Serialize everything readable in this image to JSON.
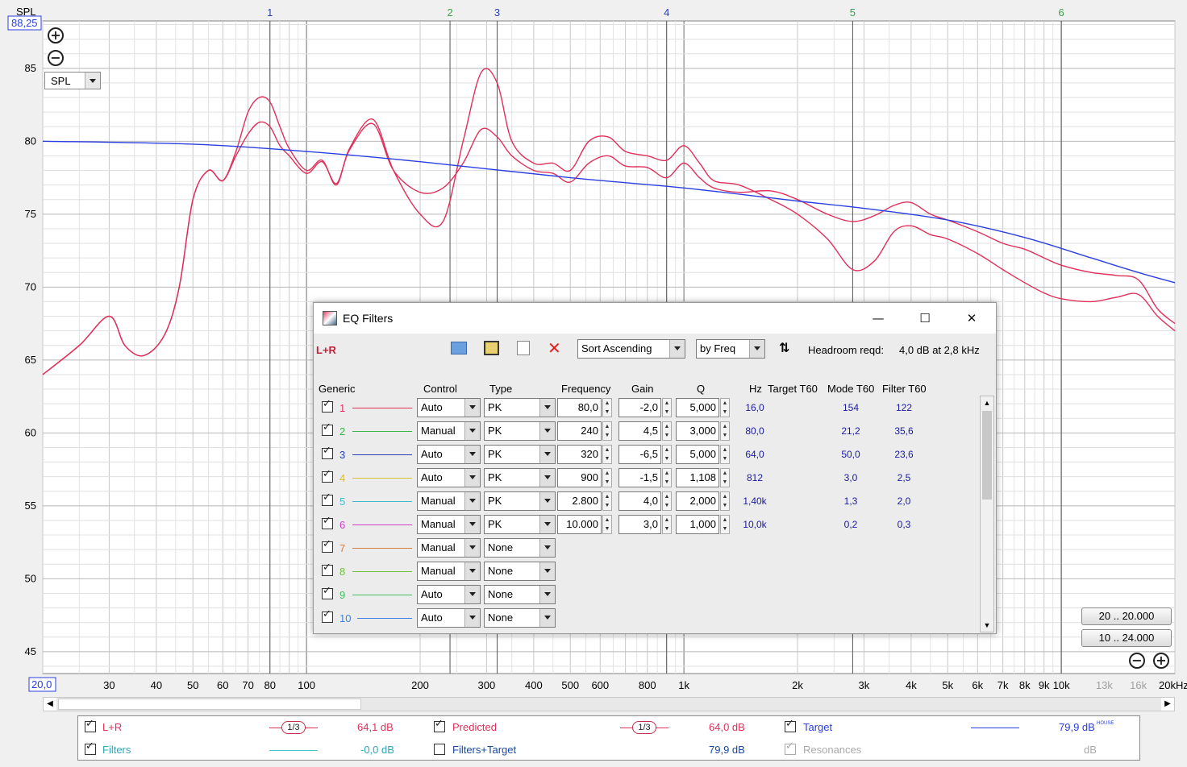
{
  "chart_data": {
    "type": "line",
    "x_scale": "log",
    "xlim": [
      20,
      20000
    ],
    "ylim": [
      43.5,
      88.25
    ],
    "ylabel": "SPL",
    "y_top_readout": "88,25",
    "x_left_readout": "20,0",
    "yticks": [
      85,
      80,
      75,
      70,
      65,
      60,
      55,
      50,
      45
    ],
    "xticks": [
      {
        "v": 30,
        "label": "30"
      },
      {
        "v": 40,
        "label": "40"
      },
      {
        "v": 50,
        "label": "50"
      },
      {
        "v": 60,
        "label": "60"
      },
      {
        "v": 70,
        "label": "70"
      },
      {
        "v": 80,
        "label": "80"
      },
      {
        "v": 100,
        "label": "100"
      },
      {
        "v": 200,
        "label": "200"
      },
      {
        "v": 300,
        "label": "300"
      },
      {
        "v": 400,
        "label": "400"
      },
      {
        "v": 500,
        "label": "500"
      },
      {
        "v": 600,
        "label": "600"
      },
      {
        "v": 800,
        "label": "800"
      },
      {
        "v": 1000,
        "label": "1k"
      },
      {
        "v": 2000,
        "label": "2k"
      },
      {
        "v": 3000,
        "label": "3k"
      },
      {
        "v": 4000,
        "label": "4k"
      },
      {
        "v": 5000,
        "label": "5k"
      },
      {
        "v": 6000,
        "label": "6k"
      },
      {
        "v": 7000,
        "label": "7k"
      },
      {
        "v": 8000,
        "label": "8k"
      },
      {
        "v": 9000,
        "label": "9k"
      },
      {
        "v": 10000,
        "label": "10k"
      },
      {
        "v": 13000,
        "label": "13k",
        "dim": true
      },
      {
        "v": 16000,
        "label": "16k",
        "dim": true
      },
      {
        "v": 20000,
        "label": "20kHz"
      }
    ],
    "filter_markers": [
      {
        "label": "1",
        "freq": 80,
        "color": "#2a3fb5"
      },
      {
        "label": "2",
        "freq": 240,
        "color": "#3aa04a"
      },
      {
        "label": "3",
        "freq": 320,
        "color": "#2a3fb5"
      },
      {
        "label": "4",
        "freq": 900,
        "color": "#2a3fb5"
      },
      {
        "label": "5",
        "freq": 2800,
        "color": "#3aa04a"
      },
      {
        "label": "6",
        "freq": 10000,
        "color": "#3aa04a"
      }
    ],
    "series": [
      {
        "name": "L+R",
        "color": "#e0305a",
        "x": [
          20,
          25,
          30,
          33,
          37,
          42,
          46,
          50,
          55,
          60,
          65,
          70,
          75,
          80,
          85,
          90,
          100,
          110,
          120,
          130,
          150,
          170,
          200,
          230,
          260,
          290,
          320,
          350,
          400,
          450,
          500,
          560,
          630,
          700,
          800,
          900,
          1000,
          1100,
          1200,
          1400,
          1700,
          2000,
          2400,
          2800,
          3200,
          3600,
          4000,
          4500,
          5000,
          6000,
          7000,
          8000,
          9000,
          10000,
          12000,
          14000,
          16000,
          18000,
          20000
        ],
        "y": [
          64,
          66,
          68,
          66,
          65.3,
          66.7,
          70,
          76,
          78,
          77.3,
          79.3,
          82,
          83,
          82.7,
          81,
          79.5,
          78,
          78.7,
          77,
          79.5,
          81.5,
          78,
          75,
          74.5,
          80,
          84.7,
          84,
          80,
          78.5,
          78.5,
          78,
          80,
          80.3,
          79.3,
          79,
          78.7,
          79.7,
          78.5,
          77.3,
          77,
          76,
          75,
          73.3,
          71.2,
          71.8,
          73.8,
          74.2,
          73.6,
          73.3,
          72.3,
          71.2,
          70.3,
          69.6,
          69.2,
          69,
          69.3,
          69.5,
          68,
          67
        ]
      },
      {
        "name": "Predicted",
        "color": "#e0305a",
        "x": [
          20,
          25,
          30,
          33,
          37,
          42,
          46,
          50,
          55,
          60,
          65,
          70,
          75,
          80,
          85,
          90,
          100,
          110,
          120,
          130,
          150,
          170,
          200,
          230,
          260,
          290,
          320,
          350,
          400,
          450,
          500,
          560,
          630,
          700,
          800,
          900,
          1000,
          1100,
          1200,
          1400,
          1700,
          2000,
          2400,
          2800,
          3200,
          3600,
          4000,
          4500,
          5000,
          6000,
          7000,
          8000,
          9000,
          10000,
          12000,
          14000,
          16000,
          18000,
          20000
        ],
        "y": [
          64,
          66,
          68,
          66,
          65.3,
          66.7,
          70,
          76,
          78,
          77.3,
          79,
          80.5,
          81.3,
          81,
          79.7,
          79,
          77.8,
          78.6,
          77.1,
          79.4,
          81.2,
          78,
          76.5,
          76.8,
          78.5,
          80.8,
          80.3,
          79,
          78,
          77.8,
          77.2,
          78.5,
          79,
          78.3,
          78.2,
          77.5,
          78.5,
          77.5,
          76.8,
          76.5,
          76.6,
          76,
          75,
          74.5,
          74.9,
          75.6,
          75.8,
          75,
          74.6,
          73.8,
          73,
          72.6,
          72,
          71.5,
          71,
          70.8,
          70.5,
          68.5,
          67.5
        ]
      },
      {
        "name": "Target",
        "color": "#2a3fe0",
        "x": [
          20,
          50,
          100,
          200,
          500,
          1000,
          2000,
          3000,
          5000,
          8000,
          12000,
          16000,
          20000
        ],
        "y": [
          80,
          79.8,
          79.3,
          78.6,
          77.5,
          76.8,
          75.9,
          75.4,
          74.6,
          73.4,
          72,
          71,
          70.3
        ]
      }
    ]
  },
  "plot": {
    "spl_selector": "SPL"
  },
  "range_buttons": [
    "20 .. 20.000",
    "10 .. 24.000"
  ],
  "eq_window": {
    "title": "EQ Filters",
    "channel": "L+R",
    "sort_order": "Sort Ascending",
    "sort_by": "by Freq",
    "headroom_label": "Headroom reqd:",
    "headroom_value": "4,0 dB at 2,8 kHz",
    "columns": {
      "generic": "Generic",
      "control": "Control",
      "type": "Type",
      "frequency": "Frequency",
      "gain": "Gain",
      "q": "Q",
      "hz": "Hz",
      "target_t60": "Target T60",
      "mode_t60": "Mode T60",
      "filter_t60": "Filter T60"
    },
    "filters": [
      {
        "num": "1",
        "color": "#e0305a",
        "control": "Auto",
        "type": "PK",
        "freq": "80,0",
        "gain": "-2,0",
        "q": "5,000",
        "hz": "16,0",
        "mode_t60": "154",
        "filter_t60": "122"
      },
      {
        "num": "2",
        "color": "#3bb54a",
        "control": "Manual",
        "type": "PK",
        "freq": "240",
        "gain": "4,5",
        "q": "3,000",
        "hz": "80,0",
        "mode_t60": "21,2",
        "filter_t60": "35,6"
      },
      {
        "num": "3",
        "color": "#2a3fb5",
        "control": "Auto",
        "type": "PK",
        "freq": "320",
        "gain": "-6,5",
        "q": "5,000",
        "hz": "64,0",
        "mode_t60": "50,0",
        "filter_t60": "23,6"
      },
      {
        "num": "4",
        "color": "#d8c030",
        "control": "Auto",
        "type": "PK",
        "freq": "900",
        "gain": "-1,5",
        "q": "1,108",
        "hz": "812",
        "mode_t60": "3,0",
        "filter_t60": "2,5"
      },
      {
        "num": "5",
        "color": "#40b8d0",
        "control": "Manual",
        "type": "PK",
        "freq": "2.800",
        "gain": "4,0",
        "q": "2,000",
        "hz": "1,40k",
        "mode_t60": "1,3",
        "filter_t60": "2,0"
      },
      {
        "num": "6",
        "color": "#d040c8",
        "control": "Manual",
        "type": "PK",
        "freq": "10.000",
        "gain": "3,0",
        "q": "1,000",
        "hz": "10,0k",
        "mode_t60": "0,2",
        "filter_t60": "0,3"
      },
      {
        "num": "7",
        "color": "#d08040",
        "control": "Manual",
        "type": "None"
      },
      {
        "num": "8",
        "color": "#70c040",
        "control": "Manual",
        "type": "None"
      },
      {
        "num": "9",
        "color": "#40c060",
        "control": "Auto",
        "type": "None"
      },
      {
        "num": "10",
        "color": "#4080e0",
        "control": "Auto",
        "type": "None"
      }
    ]
  },
  "legend": {
    "lr": {
      "label": "L+R",
      "smoothing": "1/3",
      "value": "64,1 dB",
      "checked": true,
      "color": "#e0305a"
    },
    "predicted": {
      "label": "Predicted",
      "smoothing": "1/3",
      "value": "64,0 dB",
      "checked": true,
      "color": "#e0305a"
    },
    "target": {
      "label": "Target",
      "value": "79,9 dB",
      "tag": "HOUSE",
      "checked": true,
      "color": "#2a3fe0"
    },
    "filters": {
      "label": "Filters",
      "value": "-0,0 dB",
      "checked": true,
      "color": "#40c0c0"
    },
    "filters_target": {
      "label": "Filters+Target",
      "value": "79,9 dB",
      "checked": false
    },
    "resonances": {
      "label": "Resonances",
      "value": "dB",
      "checked": true
    }
  }
}
